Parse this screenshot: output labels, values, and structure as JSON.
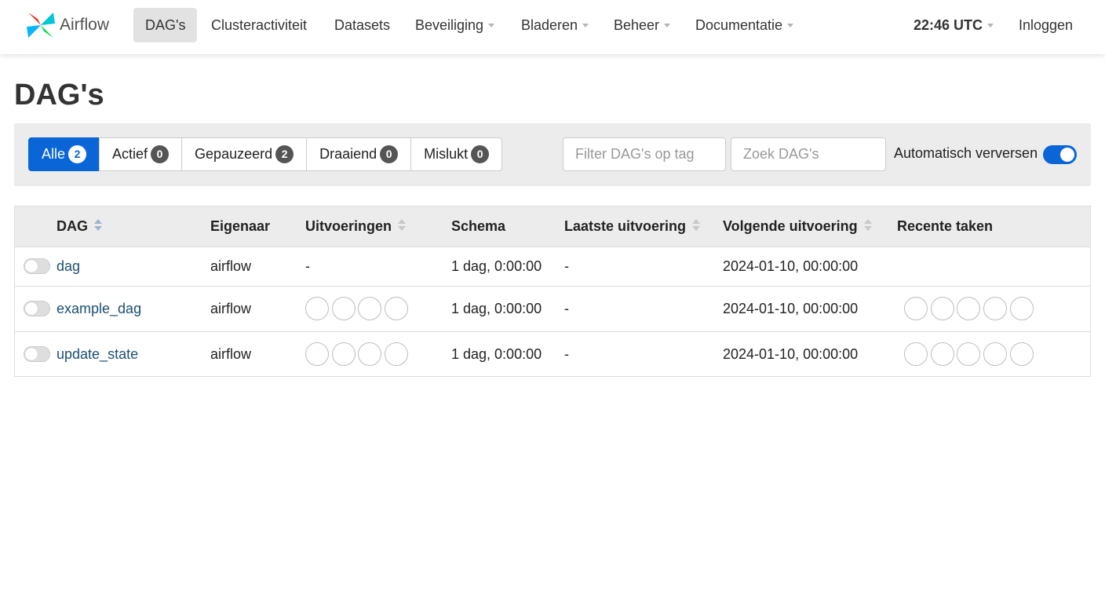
{
  "navbar": {
    "brand": "Airflow",
    "items": [
      {
        "label": "DAG's",
        "active": true,
        "caret": false
      },
      {
        "label": "Clusteractiviteit",
        "active": false,
        "caret": false
      },
      {
        "label": "Datasets",
        "active": false,
        "caret": false
      },
      {
        "label": "Beveiliging",
        "active": false,
        "caret": true
      },
      {
        "label": "Bladeren",
        "active": false,
        "caret": true
      },
      {
        "label": "Beheer",
        "active": false,
        "caret": true
      },
      {
        "label": "Documentatie",
        "active": false,
        "caret": true
      }
    ],
    "time": "22:46 UTC",
    "login": "Inloggen"
  },
  "page_title": "DAG's",
  "filters": {
    "status_buttons": [
      {
        "label": "Alle",
        "count": "2",
        "active": true
      },
      {
        "label": "Actief",
        "count": "0",
        "active": false
      },
      {
        "label": "Gepauzeerd",
        "count": "2",
        "active": false
      },
      {
        "label": "Draaiend",
        "count": "0",
        "active": false
      },
      {
        "label": "Mislukt",
        "count": "0",
        "active": false
      }
    ],
    "tag_placeholder": "Filter DAG's op tag",
    "search_placeholder": "Zoek DAG's",
    "auto_refresh_label": "Automatisch verversen",
    "auto_refresh_on": true
  },
  "table": {
    "headers": {
      "dag": "DAG",
      "owner": "Eigenaar",
      "runs": "Uitvoeringen",
      "schedule": "Schema",
      "last_run": "Laatste uitvoering",
      "next_run": "Volgende uitvoering",
      "recent_tasks": "Recente taken"
    },
    "rows": [
      {
        "dag_id": "dag",
        "owner": "airflow",
        "runs": "-",
        "schedule": "1 dag, 0:00:00",
        "last_run": "-",
        "next_run": "2024-01-10, 00:00:00",
        "run_circles": 0,
        "task_circles": 0
      },
      {
        "dag_id": "example_dag",
        "owner": "airflow",
        "runs": "",
        "schedule": "1 dag, 0:00:00",
        "last_run": "-",
        "next_run": "2024-01-10, 00:00:00",
        "run_circles": 4,
        "task_circles": 5
      },
      {
        "dag_id": "update_state",
        "owner": "airflow",
        "runs": "",
        "schedule": "1 dag, 0:00:00",
        "last_run": "-",
        "next_run": "2024-01-10, 00:00:00",
        "run_circles": 4,
        "task_circles": 5
      }
    ]
  },
  "colors": {
    "accent": "#0a66d6",
    "link": "#1a4f73"
  }
}
